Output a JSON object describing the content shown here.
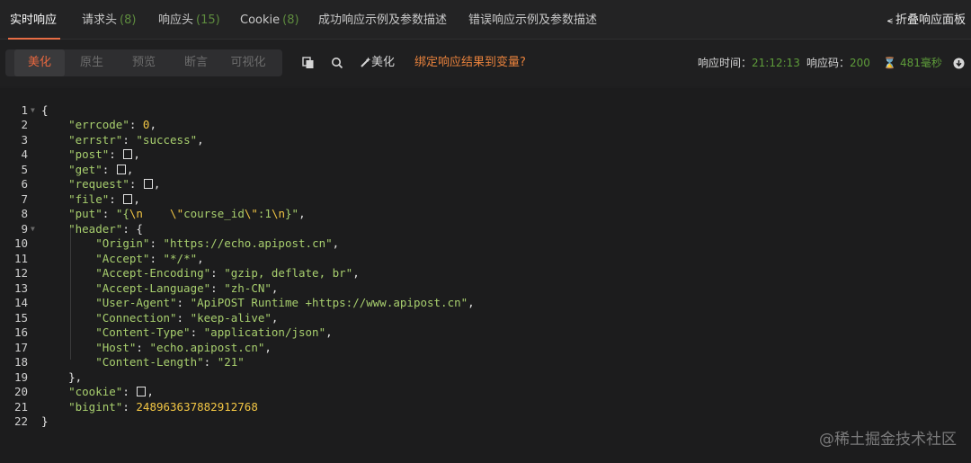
{
  "tabs": [
    {
      "label": "实时响应",
      "count": ""
    },
    {
      "label": "请求头",
      "count": "(8)"
    },
    {
      "label": "响应头",
      "count": "(15)"
    },
    {
      "label": "Cookie",
      "count": "(8)"
    },
    {
      "label": "成功响应示例及参数描述",
      "count": ""
    },
    {
      "label": "错误响应示例及参数描述",
      "count": ""
    }
  ],
  "collapse_label": "折叠响应面板",
  "view_modes": [
    "美化",
    "原生",
    "预览",
    "断言",
    "可视化"
  ],
  "toolbar": {
    "beautify_label": "美化",
    "bind_label": "绑定响应结果到变量?"
  },
  "stats": {
    "time_label": "响应时间：",
    "time_value": "21:12:13",
    "code_label": "响应码：",
    "code_value": "200",
    "duration_value": "481毫秒"
  },
  "code_lines": [
    {
      "n": "1",
      "fold": true
    },
    {
      "n": "2"
    },
    {
      "n": "3"
    },
    {
      "n": "4"
    },
    {
      "n": "5"
    },
    {
      "n": "6"
    },
    {
      "n": "7"
    },
    {
      "n": "8"
    },
    {
      "n": "9",
      "fold": true
    },
    {
      "n": "10"
    },
    {
      "n": "11"
    },
    {
      "n": "12"
    },
    {
      "n": "13"
    },
    {
      "n": "14"
    },
    {
      "n": "15"
    },
    {
      "n": "16"
    },
    {
      "n": "17"
    },
    {
      "n": "18"
    },
    {
      "n": "19"
    },
    {
      "n": "20"
    },
    {
      "n": "21"
    },
    {
      "n": "22"
    }
  ],
  "json": {
    "errcode_key": "\"errcode\"",
    "errcode_val": "0",
    "errstr_key": "\"errstr\"",
    "errstr_val": "\"success\"",
    "post_key": "\"post\"",
    "get_key": "\"get\"",
    "request_key": "\"request\"",
    "file_key": "\"file\"",
    "put_key": "\"put\"",
    "put_val_a": "\"{",
    "put_esc1": "\\n",
    "put_val_b": "    ",
    "put_esc2": "\\\"",
    "put_val_c": "course_id",
    "put_esc3": "\\\"",
    "put_val_d": ":1",
    "put_esc4": "\\n",
    "put_val_e": "}\"",
    "header_key": "\"header\"",
    "origin_key": "\"Origin\"",
    "origin_val": "\"https://echo.apipost.cn\"",
    "accept_key": "\"Accept\"",
    "accept_val": "\"*/*\"",
    "ae_key": "\"Accept-Encoding\"",
    "ae_val": "\"gzip, deflate, br\"",
    "al_key": "\"Accept-Language\"",
    "al_val": "\"zh-CN\"",
    "ua_key": "\"User-Agent\"",
    "ua_val": "\"ApiPOST Runtime +https://www.apipost.cn\"",
    "conn_key": "\"Connection\"",
    "conn_val": "\"keep-alive\"",
    "ct_key": "\"Content-Type\"",
    "ct_val": "\"application/json\"",
    "host_key": "\"Host\"",
    "host_val": "\"echo.apipost.cn\"",
    "cl_key": "\"Content-Length\"",
    "cl_val": "\"21\"",
    "cookie_key": "\"cookie\"",
    "bigint_key": "\"bigint\"",
    "bigint_val": "248963637882912768"
  },
  "watermark": "@稀土掘金技术社区"
}
